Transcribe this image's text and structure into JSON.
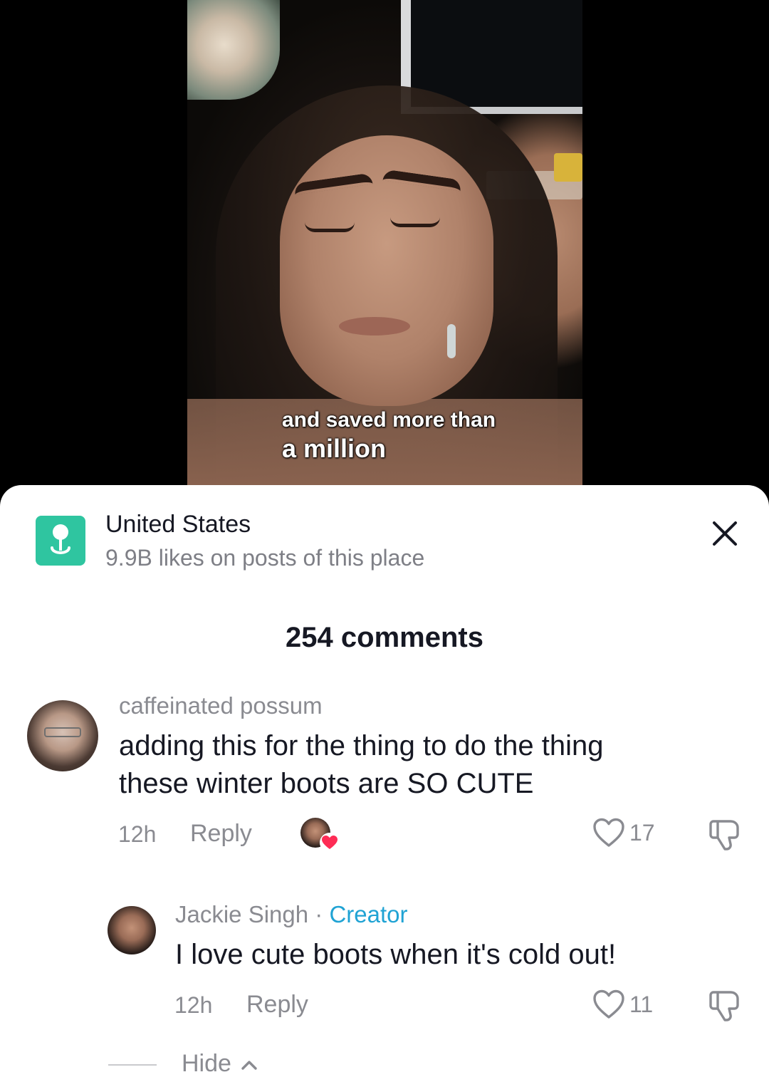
{
  "video": {
    "caption_line1": "and saved more than",
    "caption_line2": "a million"
  },
  "place": {
    "name": "United States",
    "subtitle": "9.9B likes on posts of this place",
    "icon": "location-pin-icon",
    "icon_color": "#2fc5a0"
  },
  "comments_header": {
    "count_label": "254 comments"
  },
  "comments": [
    {
      "username": "caffeinated possum",
      "text_line1": "adding this for the thing to do the thing",
      "text_line2": "these winter boots are SO CUTE",
      "time": "12h",
      "reply_label": "Reply",
      "likes": "17",
      "liked_by_creator": true
    }
  ],
  "replies": [
    {
      "username": "Jackie Singh",
      "separator": " · ",
      "badge": "Creator",
      "text": "I love cute boots when it's cold out!",
      "time": "12h",
      "reply_label": "Reply",
      "likes": "11"
    }
  ],
  "hide": {
    "label": "Hide"
  },
  "colors": {
    "creator_badge": "#20a3d4",
    "heart_badge": "#fe2c55",
    "text_primary": "#161823",
    "text_secondary": "#8a8b91"
  }
}
